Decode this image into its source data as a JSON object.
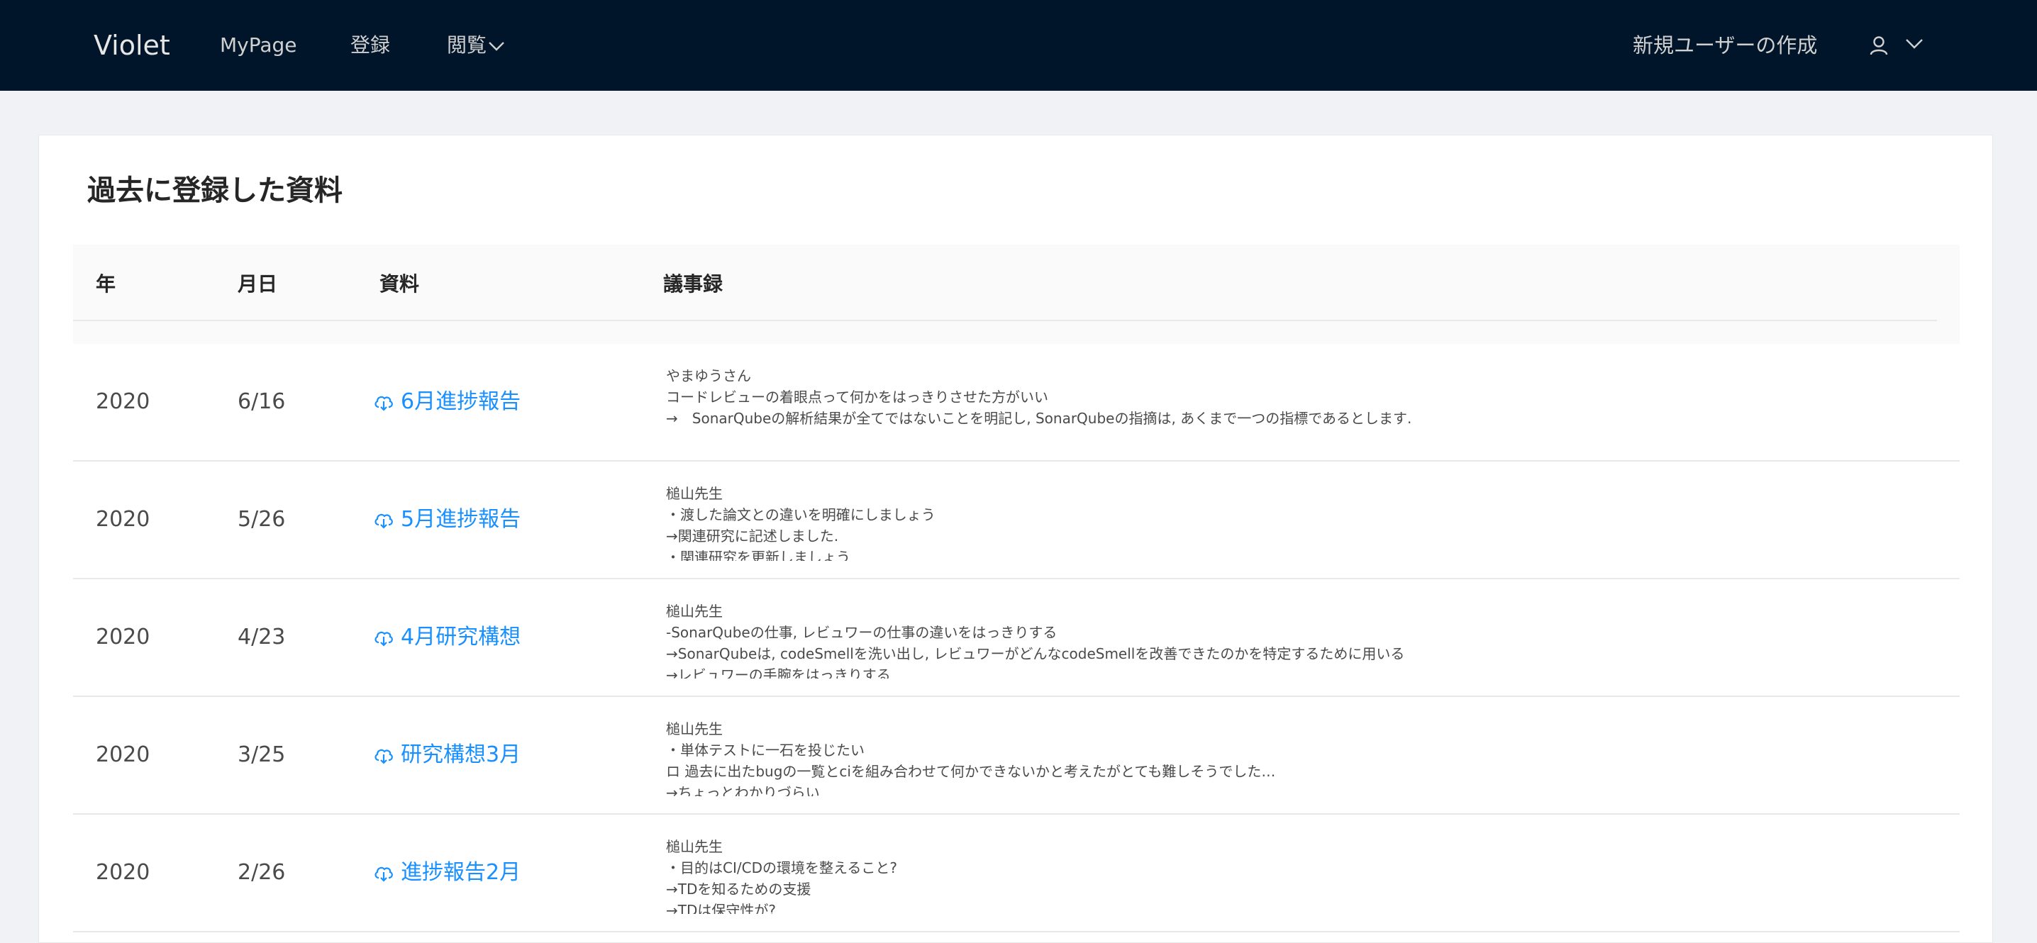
{
  "header": {
    "brand": "Violet",
    "nav": [
      {
        "label": "MyPage"
      },
      {
        "label": "登録"
      },
      {
        "label": "閲覧"
      }
    ],
    "create_user_label": "新規ユーザーの作成",
    "icons": {
      "user": "user-icon",
      "dropdown": "chevron-down-icon"
    }
  },
  "card": {
    "title": "過去に登録した資料",
    "columns": [
      "年",
      "月日",
      "資料",
      "議事録"
    ],
    "rows": [
      {
        "year": "2020",
        "date": "6/16",
        "doc": "6月進捗報告",
        "notes": [
          "やまゆうさん",
          "コードレビューの着眼点って何かをはっきりさせた方がいい",
          "→　SonarQubeの解析結果が全てではないことを明記し, SonarQubeの指摘は, あくまで一つの指標であるとします."
        ]
      },
      {
        "year": "2020",
        "date": "5/26",
        "doc": "5月進捗報告",
        "notes": [
          "槌山先生",
          "・渡した論文との違いを明確にしましょう",
          "→関連研究に記述しました.",
          "・関連研究を更新しましょう"
        ]
      },
      {
        "year": "2020",
        "date": "4/23",
        "doc": "4月研究構想",
        "notes": [
          "槌山先生",
          "-SonarQubeの仕事, レビュワーの仕事の違いをはっきりする",
          "→SonarQubeは, codeSmellを洗い出し, レビュワーがどんなcodeSmellを改善できたのかを特定するために用いる",
          "→レビュワーの手腕をはっきりする"
        ]
      },
      {
        "year": "2020",
        "date": "3/25",
        "doc": "研究構想3月",
        "notes": [
          "槌山先生",
          "・単体テストに一石を投じたい",
          "ロ 過去に出たbugの一覧とciを組み合わせて何かできないかと考えたがとても難しそうでした…",
          "→ちょっとわかりづらい"
        ]
      },
      {
        "year": "2020",
        "date": "2/26",
        "doc": "進捗報告2月",
        "notes": [
          "槌山先生",
          "・目的はCI/CDの環境を整えること?",
          "→TDを知るための支援",
          "→TDは保守性が?"
        ]
      }
    ]
  },
  "colors": {
    "header_bg": "#001529",
    "link": "#1890ff",
    "page_bg": "#f0f2f5"
  },
  "row_icon": "cloud-download-icon"
}
